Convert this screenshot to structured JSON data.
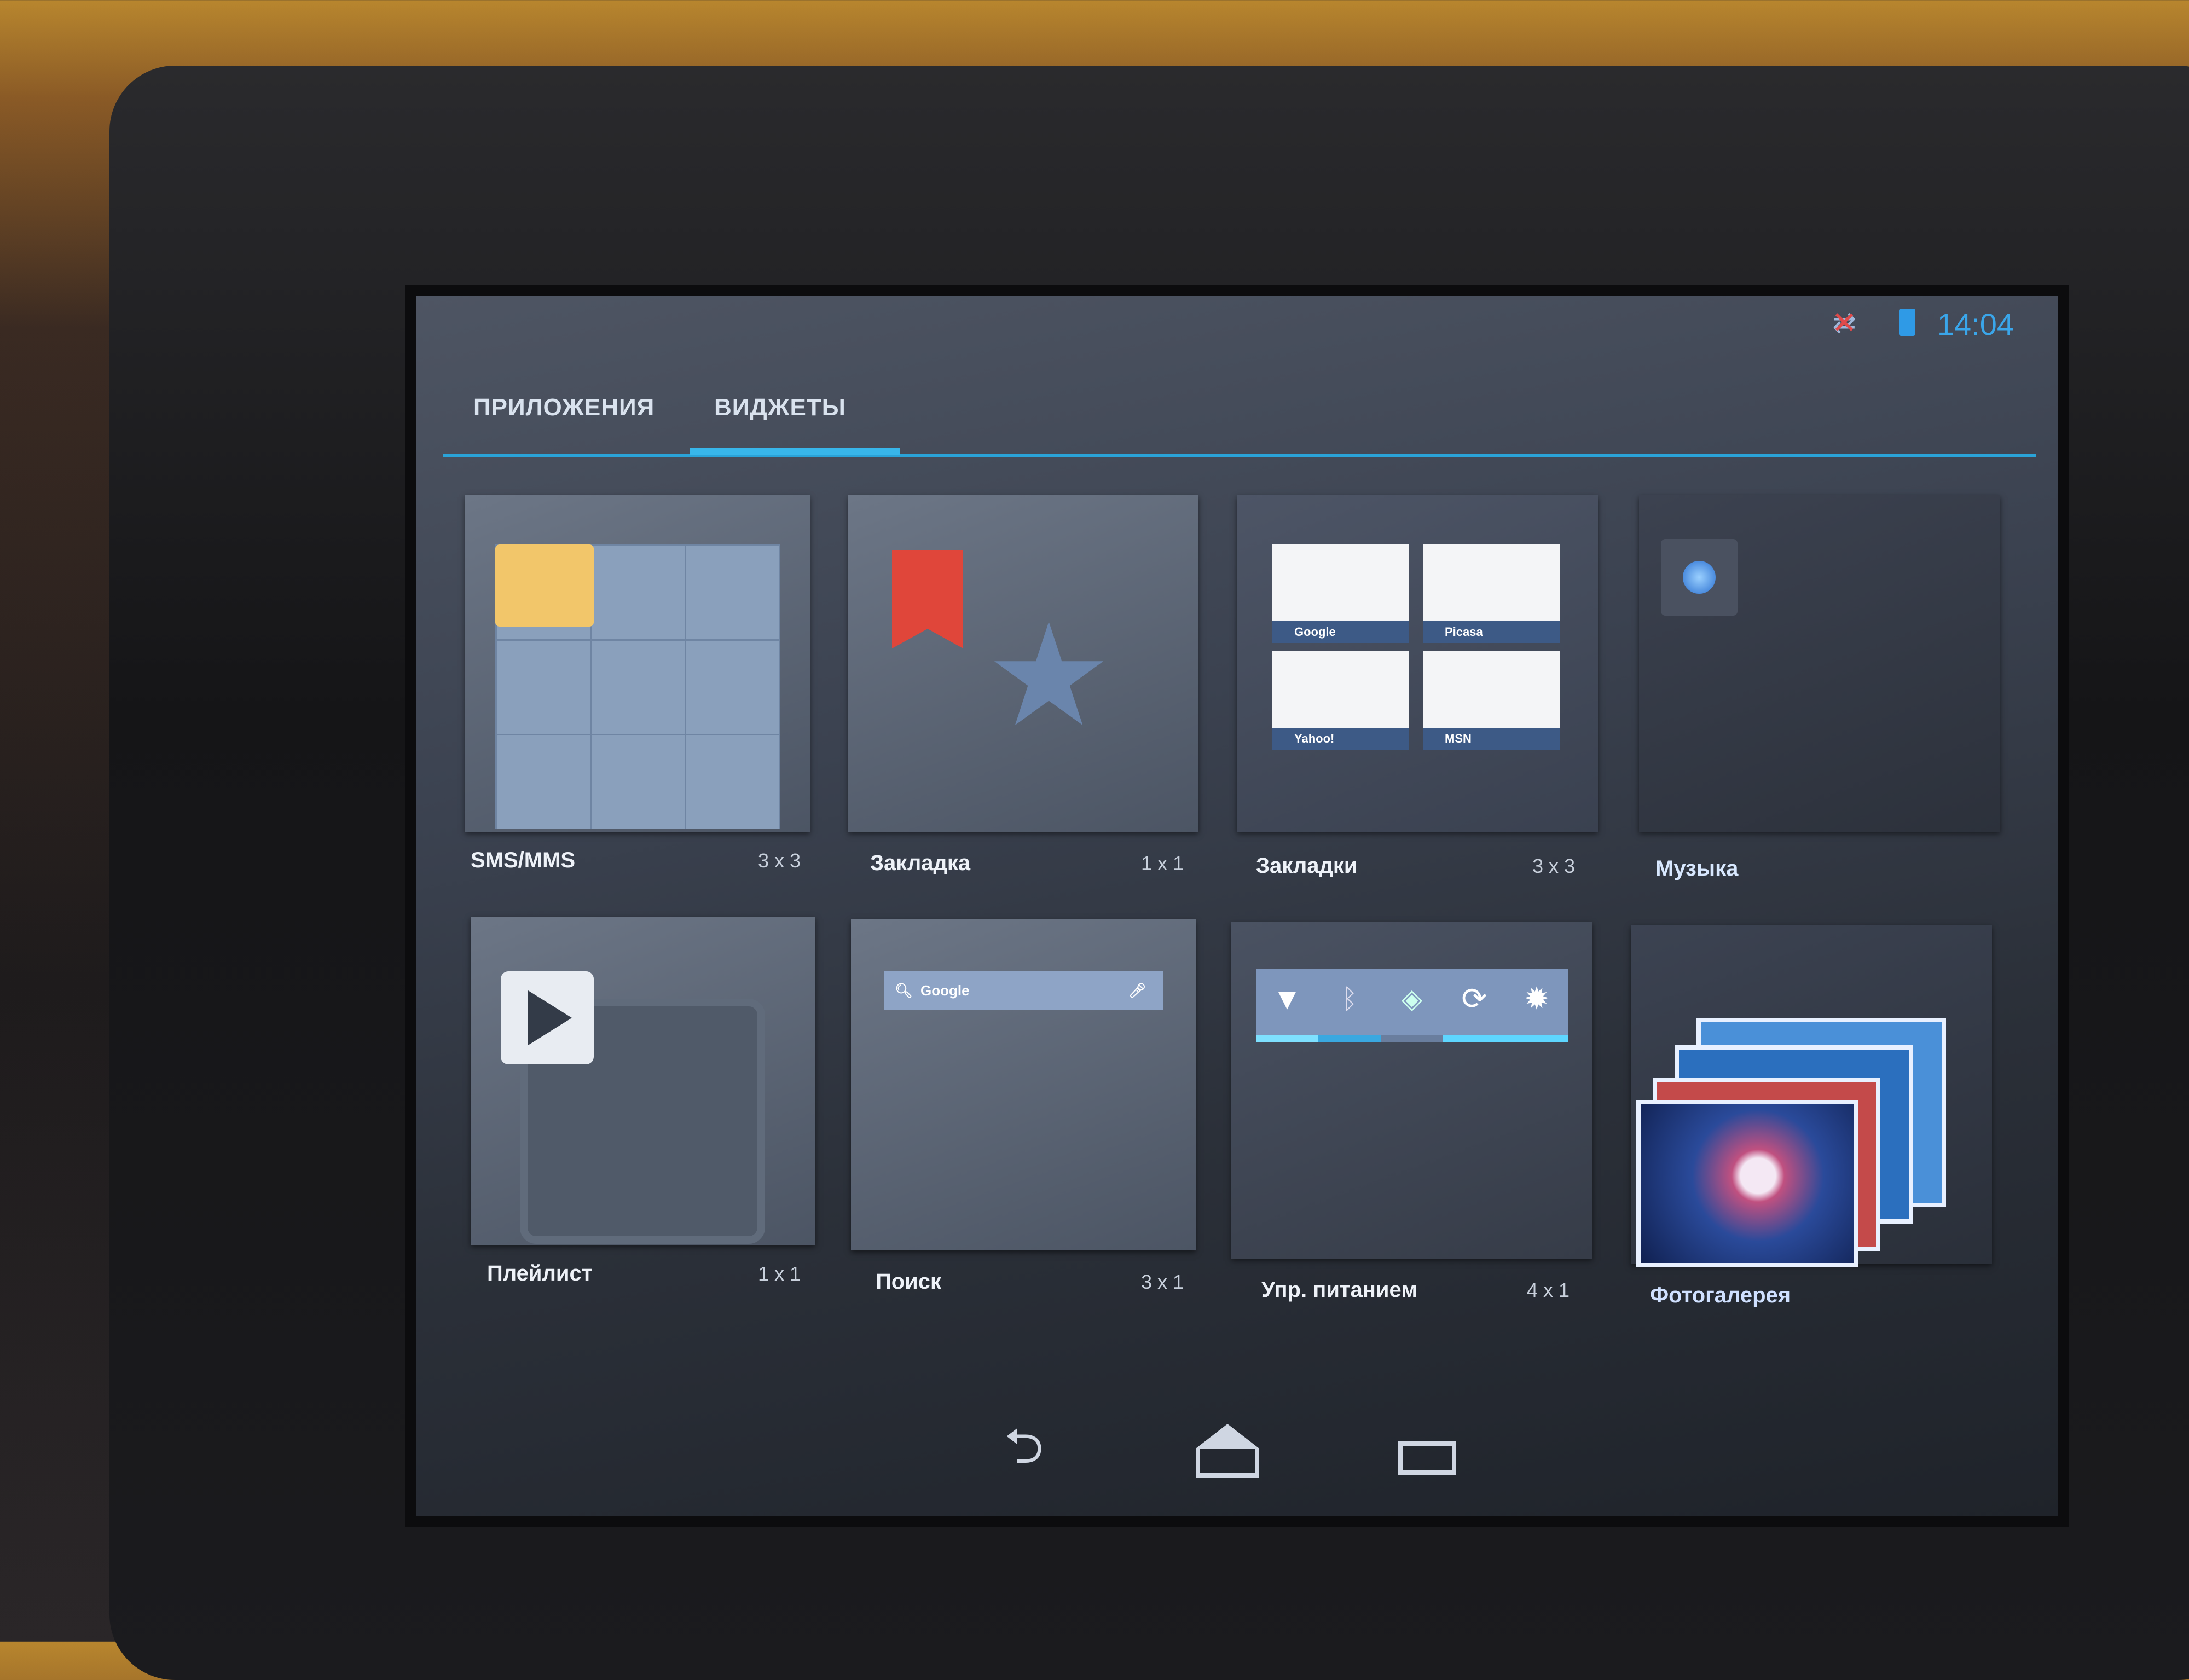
{
  "status_bar": {
    "time": "14:04",
    "icons": [
      "sync-off-icon",
      "battery-icon"
    ],
    "accent": "#33b5e5"
  },
  "tabs": [
    {
      "label": "ПРИЛОЖЕНИЯ",
      "selected": false
    },
    {
      "label": "ВИДЖЕТЫ",
      "selected": true
    }
  ],
  "widgets": [
    {
      "name": "SMS/MMS",
      "size": "3 x 3"
    },
    {
      "name": "Закладка",
      "size": "1 x 1"
    },
    {
      "name": "Закладки",
      "size": "3 x 3",
      "thumbnails": [
        "Google",
        "Picasa",
        "Yahoo!",
        "MSN"
      ]
    },
    {
      "name": "Музыка",
      "size": ""
    },
    {
      "name": "Плейлист",
      "size": "1 x 1"
    },
    {
      "name": "Поиск",
      "size": "3 x 1",
      "search_hint": "Google"
    },
    {
      "name": "Упр. питанием",
      "size": "4 x 1",
      "toggles": [
        "wifi-icon",
        "bluetooth-icon",
        "gps-icon",
        "sync-icon",
        "brightness-icon"
      ]
    },
    {
      "name": "Фотогалерея",
      "size": ""
    }
  ],
  "nav": [
    "back-icon",
    "home-icon",
    "recent-apps-icon"
  ]
}
